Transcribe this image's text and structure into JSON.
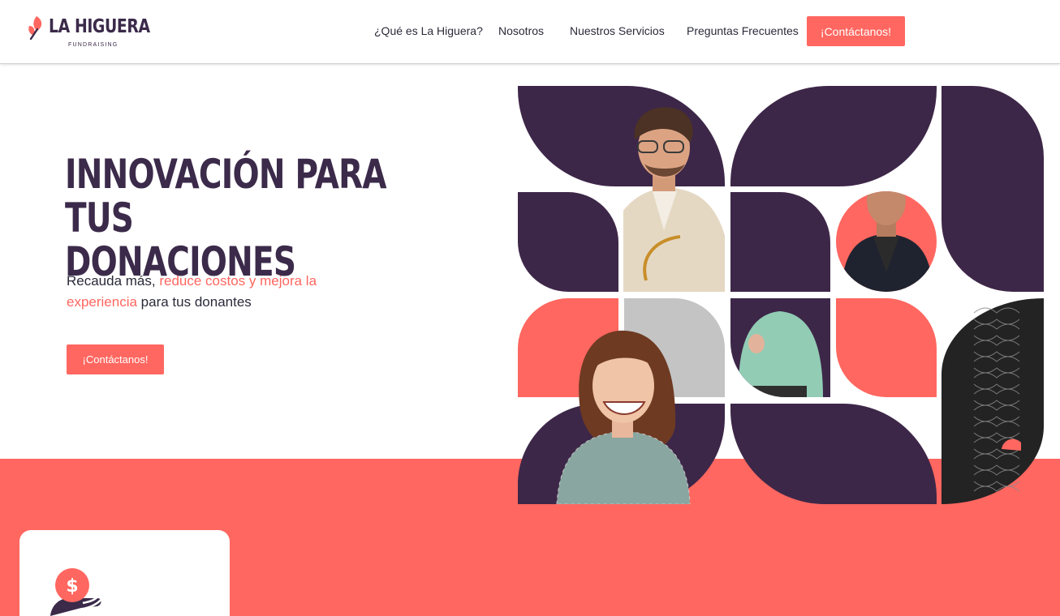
{
  "brand": {
    "name": "LA HIGUERA",
    "tagline": "FUNDRAISING",
    "color_primary": "#3b2a4a",
    "color_accent": "#ff6760"
  },
  "nav": {
    "items": [
      {
        "label": "¿Qué es La Higuera?"
      },
      {
        "label": "Nosotros"
      },
      {
        "label": "Nuestros Servicios"
      },
      {
        "label": "Preguntas Frecuentes"
      }
    ],
    "cta_label": "¡Contáctanos!"
  },
  "hero": {
    "title_line1": "INNOVACIÓN PARA TUS",
    "title_line2": "DONACIONES",
    "subtitle_part1": "Recauda más, ",
    "subtitle_accent": "reduce costos y mejora la experiencia",
    "subtitle_part2": " para tus donantes",
    "cta_label": "¡Contáctanos!"
  },
  "collage": {
    "colors": {
      "purple": "#3d2748",
      "coral": "#ff6760",
      "gray": "#c4c4c4",
      "dark": "#232323"
    },
    "photos": [
      "man-with-phone",
      "man-in-suit",
      "woman-in-green-shirt",
      "laughing-woman"
    ]
  },
  "feature_card": {
    "icon": "dollar-coin-hand-icon"
  }
}
